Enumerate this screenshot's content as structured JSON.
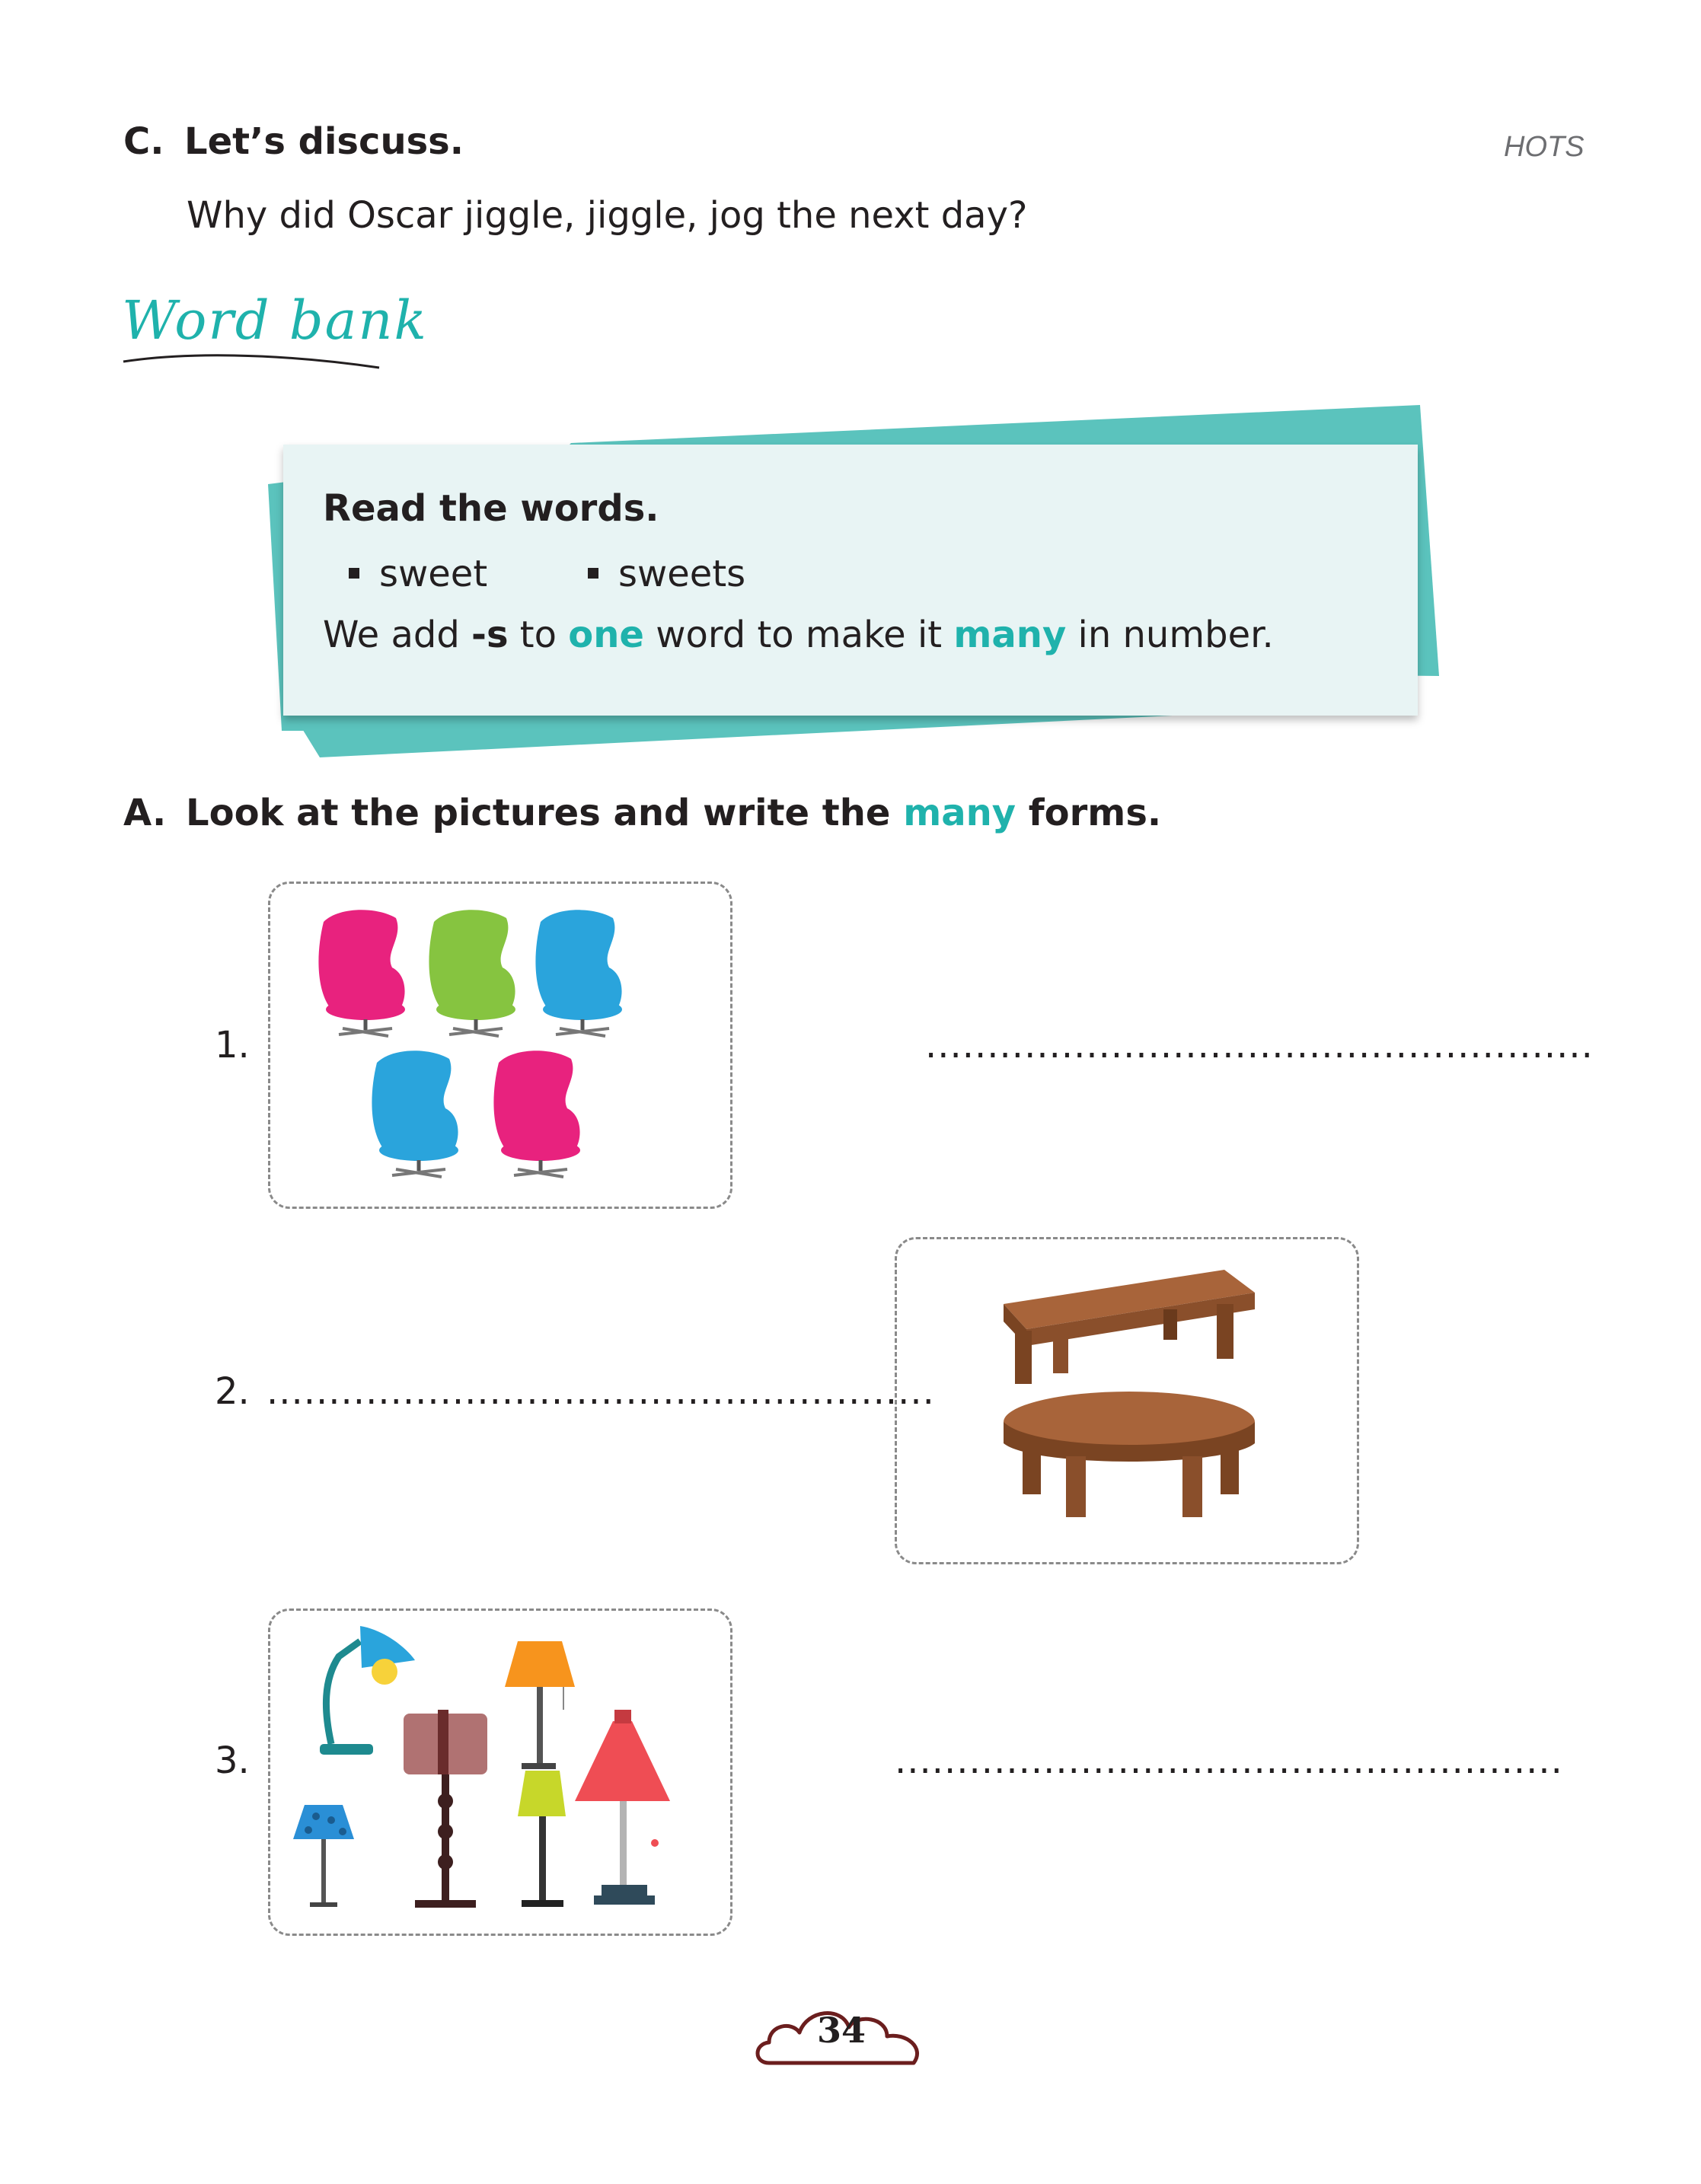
{
  "section_c": {
    "label": "C.",
    "title": "Let’s discuss.",
    "tag": "HOTS",
    "question": "Why did Oscar jiggle, jiggle, jog the next day?"
  },
  "word_bank": {
    "title": "Word bank",
    "instruction": "Read the words.",
    "words": [
      "sweet",
      "sweets"
    ],
    "rule": {
      "part1": "We add ",
      "suffix": "-s",
      "part2": " to ",
      "one": "one",
      "part3": " word to make it ",
      "many": "many",
      "part4": " in number."
    }
  },
  "section_a": {
    "label": "A.",
    "title_part1": "Look at the pictures and write the ",
    "title_many": "many",
    "title_part2": " forms.",
    "items": [
      {
        "number": "1.",
        "picture": "chairs-picture",
        "answer_line": "......................................................"
      },
      {
        "number": "2.",
        "picture": "tables-picture",
        "answer_line": "......................................................"
      },
      {
        "number": "3.",
        "picture": "lamps-picture",
        "answer_line": "......................................................"
      }
    ]
  },
  "colors": {
    "accent": "#1fb2ac",
    "card_bg": "#e8f4f4"
  },
  "page_number": "34"
}
